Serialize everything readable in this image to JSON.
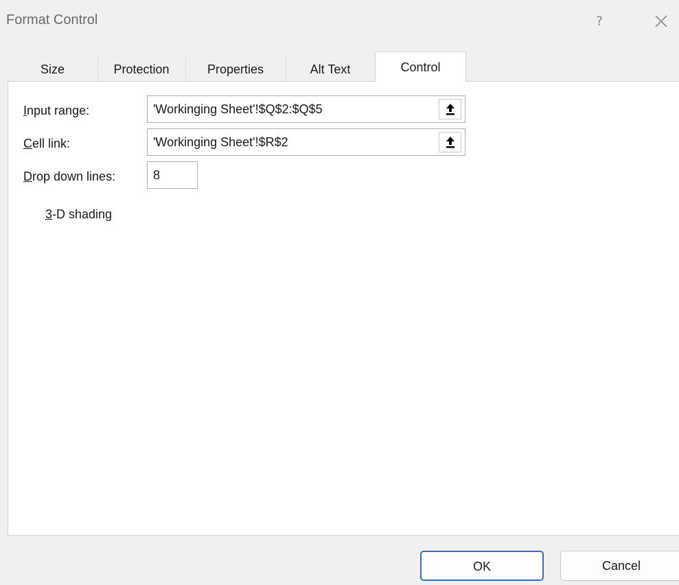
{
  "dialog": {
    "title": "Format Control",
    "help_label": "?"
  },
  "tabs": [
    {
      "label": "Size",
      "active": false
    },
    {
      "label": "Protection",
      "active": false
    },
    {
      "label": "Properties",
      "active": false
    },
    {
      "label": "Alt Text",
      "active": false
    },
    {
      "label": "Control",
      "active": true
    }
  ],
  "control": {
    "input_range": {
      "label_accel": "I",
      "label_rest": "nput range:",
      "value": "'Workinging Sheet'!$Q$2:$Q$5"
    },
    "cell_link": {
      "label_accel": "C",
      "label_rest": "ell link:",
      "value": "'Workinging Sheet'!$R$2"
    },
    "drop_down_lines": {
      "label_accel": "D",
      "label_rest": "rop down lines:",
      "value": "8"
    },
    "shading": {
      "label_accel": "3",
      "label_rest": "-D shading",
      "checked": false
    }
  },
  "buttons": {
    "ok": "OK",
    "cancel": "Cancel"
  },
  "colors": {
    "ok_border": "#2f6dc6",
    "background": "#f0f0f0",
    "panel": "#ffffff"
  }
}
